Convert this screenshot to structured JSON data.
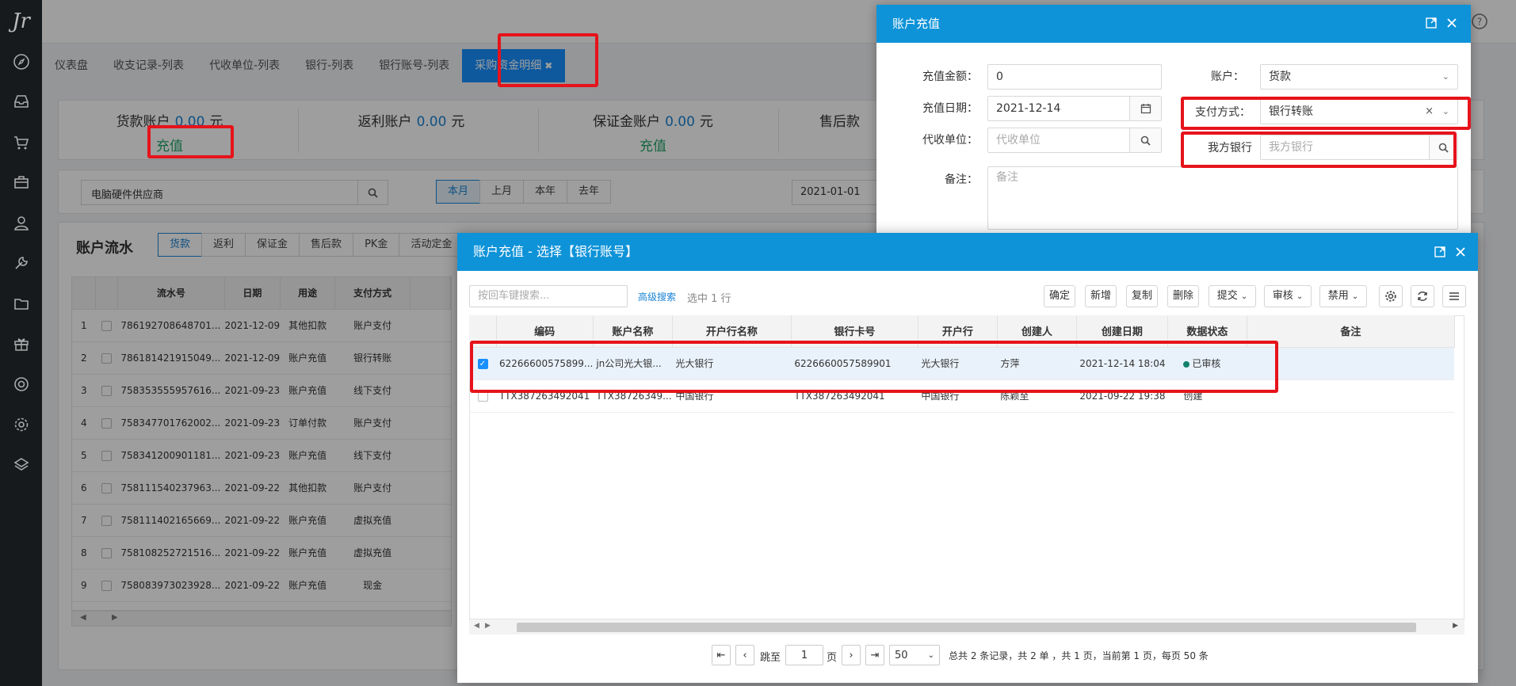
{
  "sidebar": {
    "logo": "Jr",
    "icons": [
      "compass-icon",
      "inbox-icon",
      "cart-icon",
      "briefcase-icon",
      "user-icon",
      "wrench-icon",
      "folder-icon",
      "gift-icon",
      "lifebuoy-icon",
      "gear-icon",
      "layers-icon"
    ]
  },
  "tabs": [
    {
      "label": "仪表盘"
    },
    {
      "label": "收支记录-列表"
    },
    {
      "label": "代收单位-列表"
    },
    {
      "label": "银行-列表"
    },
    {
      "label": "银行账号-列表"
    },
    {
      "label": "采购资金明细",
      "active": true,
      "close": "✖"
    }
  ],
  "accounts": {
    "payment": {
      "label": "货款账户",
      "value": "0.00",
      "unit": "元",
      "action": "充值"
    },
    "rebate": {
      "label": "返利账户",
      "value": "0.00",
      "unit": "元"
    },
    "deposit": {
      "label": "保证金账户",
      "value": "0.00",
      "unit": "元",
      "action": "充值"
    },
    "aftersale": {
      "label": "售后款"
    }
  },
  "filter": {
    "supplier": "电脑硬件供应商",
    "periods": [
      "本月",
      "上月",
      "本年",
      "去年"
    ],
    "date_from": "2021-01-01"
  },
  "flow": {
    "title": "账户流水",
    "sub_tabs": [
      "货款",
      "返利",
      "保证金",
      "售后款",
      "PK金",
      "活动定金"
    ],
    "columns": [
      "流水号",
      "日期",
      "用途",
      "支付方式"
    ],
    "rows": [
      {
        "no": "1",
        "serial": "786192708648701...",
        "date": "2021-12-09",
        "usage": "其他扣款",
        "pay": "账户支付"
      },
      {
        "no": "2",
        "serial": "786181421915049...",
        "date": "2021-12-09",
        "usage": "账户充值",
        "pay": "银行转账"
      },
      {
        "no": "3",
        "serial": "758353555957616...",
        "date": "2021-09-23",
        "usage": "账户充值",
        "pay": "线下支付"
      },
      {
        "no": "4",
        "serial": "758347701762002...",
        "date": "2021-09-23",
        "usage": "订单付款",
        "pay": "账户支付"
      },
      {
        "no": "5",
        "serial": "758341200901181...",
        "date": "2021-09-23",
        "usage": "账户充值",
        "pay": "线下支付"
      },
      {
        "no": "6",
        "serial": "758111540237963...",
        "date": "2021-09-22",
        "usage": "其他扣款",
        "pay": "账户支付"
      },
      {
        "no": "7",
        "serial": "758111402165669...",
        "date": "2021-09-22",
        "usage": "账户充值",
        "pay": "虚拟充值"
      },
      {
        "no": "8",
        "serial": "758108252721516...",
        "date": "2021-09-22",
        "usage": "账户充值",
        "pay": "虚拟充值"
      },
      {
        "no": "9",
        "serial": "758083973023928...",
        "date": "2021-09-22",
        "usage": "账户充值",
        "pay": "现金"
      }
    ]
  },
  "recharge": {
    "title": "账户充值",
    "amount_label": "充值金额：",
    "amount": "0",
    "date_label": "充值日期：",
    "date": "2021-12-14",
    "collector_label": "代收单位：",
    "collector_placeholder": "代收单位",
    "note_label": "备注：",
    "note_placeholder": "备注",
    "account_label": "账户：",
    "account": "货款",
    "pay_label": "支付方式：",
    "pay": "银行转账",
    "bank_label": "我方银行",
    "bank_placeholder": "我方银行"
  },
  "bank_dialog": {
    "title": "账户充值 - 选择【银行账号】",
    "search_placeholder": "按回车键搜索...",
    "advanced": "高级搜索",
    "selected": "选中 1 行",
    "toolbar": {
      "confirm": "确定",
      "add": "新增",
      "copy": "复制",
      "delete": "删除",
      "submit": "提交",
      "audit": "审核",
      "disable": "禁用"
    },
    "columns": [
      "编码",
      "账户名称",
      "开户行名称",
      "银行卡号",
      "开户行",
      "创建人",
      "创建日期",
      "数据状态",
      "备注"
    ],
    "rows": [
      {
        "code": "62266600575899...",
        "name": "jn公司光大银...",
        "bank_name": "光大银行",
        "card": "6226660057589901",
        "bank": "光大银行",
        "creator": "方萍",
        "created": "2021-12-14 18:04",
        "status": "已审核",
        "selected": true
      },
      {
        "code": "TTX387263492041",
        "name": "TTX38726349...",
        "bank_name": "中国银行",
        "card": "TTX387263492041",
        "bank": "中国银行",
        "creator": "陈颖至",
        "created": "2021-09-22 19:38",
        "status": "创建",
        "selected": false
      }
    ],
    "pager": {
      "goto": "跳至",
      "page": "1",
      "page_unit": "页",
      "size": "50",
      "summary": "总共 2 条记录，共 2 单 ，共 1 页，当前第 1 页，每页 50 条"
    }
  },
  "colors": {
    "accent": "#0e93d8",
    "highlight": "#e6131b",
    "green": "#23a46a",
    "sidebar": "#161a1d"
  }
}
